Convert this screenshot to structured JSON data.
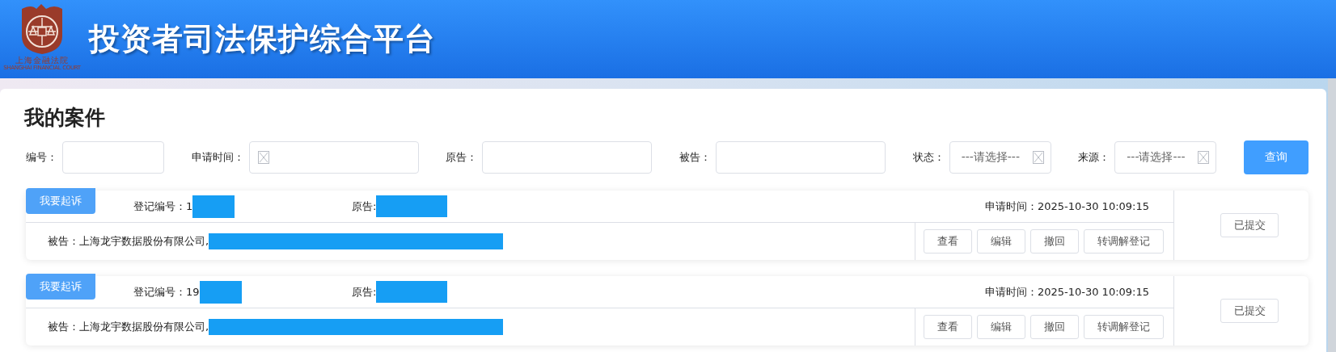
{
  "header": {
    "logo": {
      "name_cn": "上海金融法院",
      "name_en": "SHANGHAI FINANCIAL COURT"
    },
    "title": "投资者司法保护综合平台"
  },
  "page_title": "我的案件",
  "filters": [
    {
      "kind": "text",
      "label": "编号："
    },
    {
      "kind": "date",
      "label": "申请时间："
    },
    {
      "kind": "text",
      "label": "原告："
    },
    {
      "kind": "text",
      "label": "被告："
    },
    {
      "kind": "select",
      "label": "状态：",
      "placeholder": "---请选择---"
    },
    {
      "kind": "select",
      "label": "来源：",
      "placeholder": "---请选择---"
    }
  ],
  "search_button": "查询",
  "cases": [
    {
      "tag": "我要起诉",
      "reg_label": "登记编号：",
      "reg_no": "1",
      "plaintiff_label": "原告:",
      "date_label": "申请时间：",
      "date": "2025-10-30 10:09:15",
      "defendant_label": "被告：",
      "defendant": "上海龙宇数据股份有限公司,",
      "actions": [
        "查看",
        "编辑",
        "撤回",
        "转调解登记"
      ],
      "status": "已提交"
    },
    {
      "tag": "我要起诉",
      "reg_label": "登记编号：",
      "reg_no": "19",
      "plaintiff_label": "原告:",
      "date_label": "申请时间：",
      "date": "2025-10-30 10:09:15",
      "defendant_label": "被告：",
      "defendant": "上海龙宇数据股份有限公司,",
      "actions": [
        "查看",
        "编辑",
        "撤回",
        "转调解登记"
      ],
      "status": "已提交"
    }
  ]
}
